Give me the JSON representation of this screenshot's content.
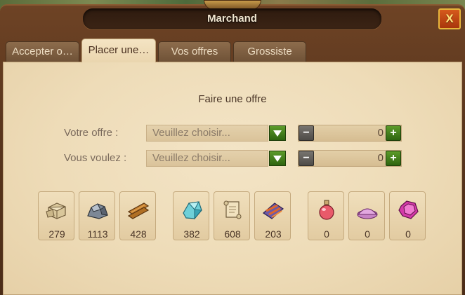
{
  "window": {
    "title": "Marchand",
    "close_label": "X"
  },
  "tabs": [
    {
      "label": "Accepter o…",
      "active": false
    },
    {
      "label": "Placer une…",
      "active": true
    },
    {
      "label": "Vos offres",
      "active": false
    },
    {
      "label": "Grossiste",
      "active": false
    }
  ],
  "offer_form": {
    "heading": "Faire une offre",
    "your_offer": {
      "label": "Votre offre :",
      "select_placeholder": "Veuillez choisir...",
      "quantity": "0"
    },
    "you_want": {
      "label": "Vous voulez :",
      "select_placeholder": "Veuillez choisir...",
      "quantity": "0"
    }
  },
  "resources": [
    {
      "icon": "stone-icon",
      "count": "279"
    },
    {
      "icon": "ore-icon",
      "count": "1113"
    },
    {
      "icon": "planks-icon",
      "count": "428"
    },
    {
      "icon": "crystal-icon",
      "count": "382"
    },
    {
      "icon": "scroll-icon",
      "count": "608"
    },
    {
      "icon": "silk-icon",
      "count": "203"
    },
    {
      "icon": "elixir-icon",
      "count": "0"
    },
    {
      "icon": "magic-dust-icon",
      "count": "0"
    },
    {
      "icon": "gem-icon",
      "count": "0"
    }
  ],
  "colors": {
    "frame_wood": "#5a361d",
    "parchment": "#eedcb8",
    "accent_green": "#3f7f1b",
    "close_red": "#c0461a"
  }
}
